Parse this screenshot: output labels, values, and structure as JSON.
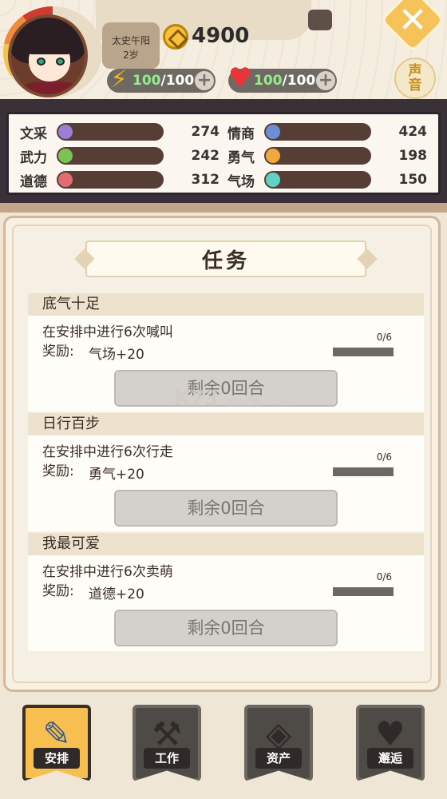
{
  "player": {
    "name": "太史午阳",
    "age": "2岁",
    "coins": "4900",
    "energy": {
      "value": "100",
      "max": "/100"
    },
    "health": {
      "value": "100",
      "max": "/100"
    }
  },
  "sound_badge": {
    "line1": "声",
    "line2": "音"
  },
  "attributes": [
    {
      "label": "文采",
      "value": "274",
      "color": "#9b7fd1"
    },
    {
      "label": "情商",
      "value": "424",
      "color": "#6b8fd6"
    },
    {
      "label": "武力",
      "value": "242",
      "color": "#7cc24f"
    },
    {
      "label": "勇气",
      "value": "198",
      "color": "#f2a93b"
    },
    {
      "label": "道德",
      "value": "312",
      "color": "#e06d74"
    },
    {
      "label": "气场",
      "value": "150",
      "color": "#5fd1c5"
    }
  ],
  "modal": {
    "title": "任务",
    "close_label": "✕"
  },
  "tasks": [
    {
      "name": "底气十足",
      "desc": "在安排中进行6次喊叫",
      "reward_label": "奖励:",
      "reward": "气场+20",
      "progress": "0/6",
      "button": "剩余0回合"
    },
    {
      "name": "日行百步",
      "desc": "在安排中进行6次行走",
      "reward_label": "奖励:",
      "reward": "勇气+20",
      "progress": "0/6",
      "button": "剩余0回合"
    },
    {
      "name": "我最可爱",
      "desc": "在安排中进行6次卖萌",
      "reward_label": "奖励:",
      "reward": "道德+20",
      "progress": "0/6",
      "button": "剩余0回合"
    }
  ],
  "watermark": {
    "main": "K73",
    "sub": "游戏之家",
    "domain": ".com"
  },
  "nav": [
    {
      "label": "安排",
      "icon": "notepad-pencil-icon",
      "active": true
    },
    {
      "label": "工作",
      "icon": "hammer-icon",
      "active": false
    },
    {
      "label": "资产",
      "icon": "coin-icon",
      "active": false
    },
    {
      "label": "邂逅",
      "icon": "heart-arrow-icon",
      "active": false
    }
  ]
}
